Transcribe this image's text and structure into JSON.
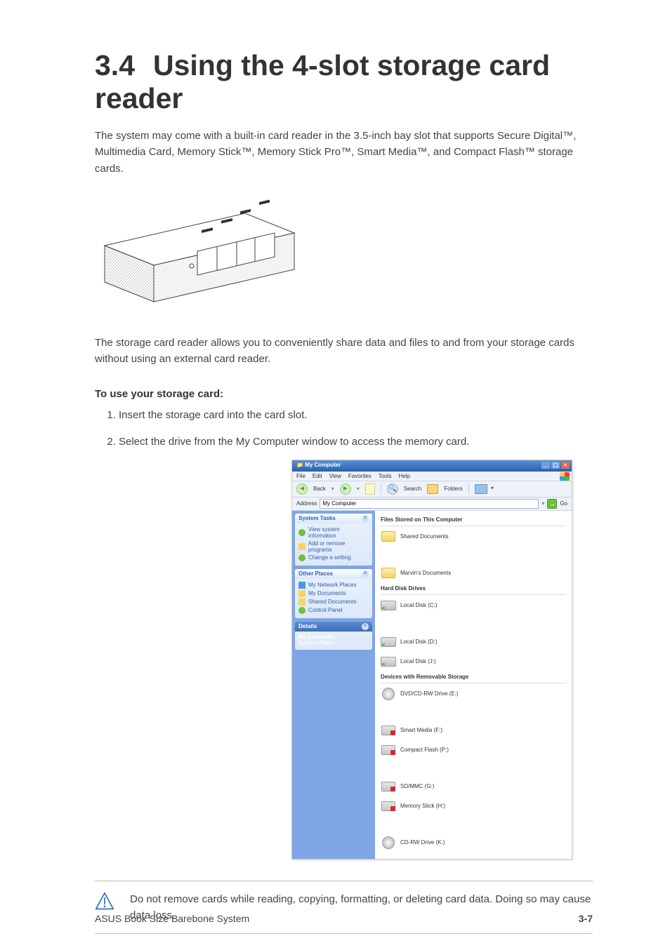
{
  "heading": {
    "number": "3.4",
    "title": "Using the 4-slot storage card reader"
  },
  "intro": "The system may come with a built-in card reader in the 3.5-inch bay slot that supports Secure Digital™, Multimedia Card, Memory Stick™, Memory Stick Pro™, Smart Media™, and Compact Flash™ storage cards.",
  "note": "The storage card reader allows you to conveniently share data and files to and from your storage cards without using an external card reader.",
  "subhead": "To use your storage card:",
  "steps": [
    "Insert the storage card into the card slot.",
    "Select the drive from the My Computer window to access the memory card."
  ],
  "screenshot": {
    "title": "My Computer",
    "menu": [
      "File",
      "Edit",
      "View",
      "Favorites",
      "Tools",
      "Help"
    ],
    "toolbar": {
      "back": "Back",
      "search": "Search",
      "folders": "Folders"
    },
    "address": {
      "label": "Address",
      "value": "My Computer",
      "go": "Go"
    },
    "panels": {
      "systemTasks": {
        "header": "System Tasks",
        "items": [
          "View system information",
          "Add or remove programs",
          "Change a setting"
        ]
      },
      "otherPlaces": {
        "header": "Other Places",
        "items": [
          "My Network Places",
          "My Documents",
          "Shared Documents",
          "Control Panel"
        ]
      },
      "details": {
        "header": "Details",
        "title": "My Computer",
        "subtitle": "System Folder"
      }
    },
    "sections": {
      "filesStored": {
        "header": "Files Stored on This Computer",
        "items": [
          "Shared Documents",
          "Marvin's Documents"
        ]
      },
      "hardDisks": {
        "header": "Hard Disk Drives",
        "items": [
          "Local Disk (C:)",
          "Local Disk (D:)",
          "Local Disk (J:)"
        ]
      },
      "removable": {
        "header": "Devices with Removable Storage",
        "items": [
          "DVD/CD-RW Drive (E:)",
          "Smart Media (F:)",
          "Compact Flash (P:)",
          "SD/MMC (G:)",
          "Memory Stick (H:)",
          "CD-RW Drive (K:)"
        ]
      }
    }
  },
  "caution": "Do not remove cards while reading, copying, formatting, or deleting card data. Doing so may cause data loss.",
  "footer": {
    "left": "ASUS Book Size Barebone System",
    "right": "3-7"
  }
}
